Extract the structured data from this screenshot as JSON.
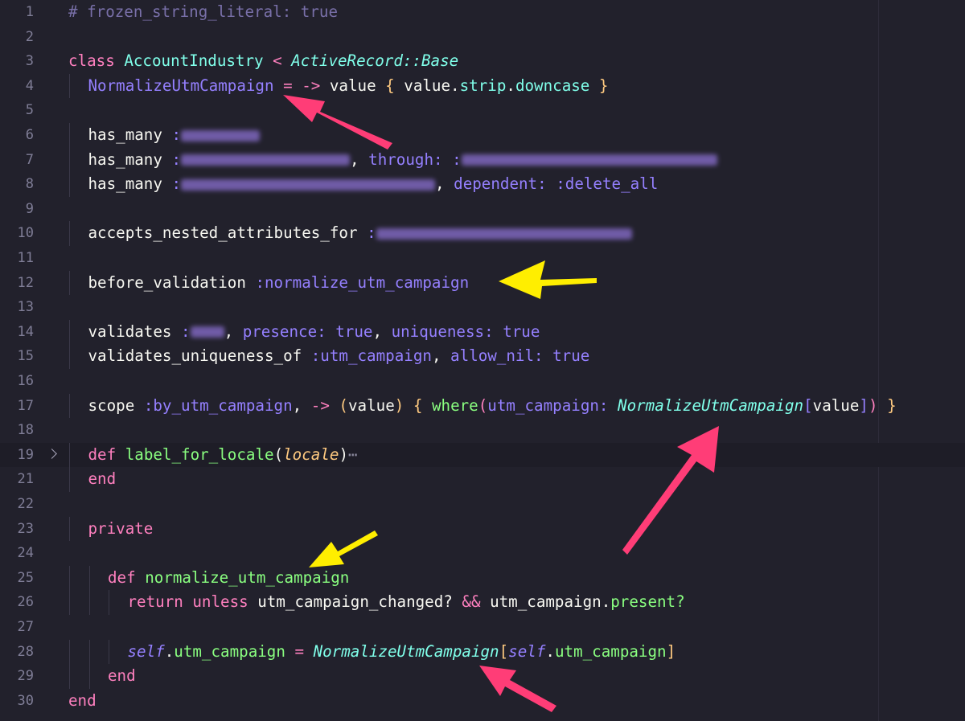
{
  "editor": {
    "lines": [
      {
        "n": "1",
        "segments": [
          {
            "t": "# frozen_string_literal: true",
            "c": "c-com"
          }
        ]
      },
      {
        "n": "2",
        "segments": []
      },
      {
        "n": "3",
        "segments": [
          {
            "t": "class ",
            "c": "c-kw"
          },
          {
            "t": "AccountIndustry",
            "c": "c-cls"
          },
          {
            "t": " < ",
            "c": "c-op"
          },
          {
            "t": "ActiveRecord::Base",
            "c": "c-anc"
          }
        ]
      },
      {
        "n": "4",
        "indent": 1,
        "segments": [
          {
            "t": "NormalizeUtmCampaign",
            "c": "c-const"
          },
          {
            "t": " = ",
            "c": "c-op"
          },
          {
            "t": "-> ",
            "c": "c-op"
          },
          {
            "t": "value ",
            "c": "c-plain"
          },
          {
            "t": "{ ",
            "c": "c-brk"
          },
          {
            "t": "value",
            "c": "c-plain"
          },
          {
            "t": ".",
            "c": "c-plain"
          },
          {
            "t": "strip",
            "c": "c-cyan"
          },
          {
            "t": ".",
            "c": "c-plain"
          },
          {
            "t": "downcase",
            "c": "c-cyan"
          },
          {
            "t": " }",
            "c": "c-brk"
          }
        ]
      },
      {
        "n": "5",
        "segments": []
      },
      {
        "n": "6",
        "indent": 1,
        "segments": [
          {
            "t": "has_many ",
            "c": "c-plain"
          },
          {
            "t": ":",
            "c": "c-sym"
          },
          {
            "blur": true,
            "w": 98
          }
        ]
      },
      {
        "n": "7",
        "indent": 1,
        "segments": [
          {
            "t": "has_many ",
            "c": "c-plain"
          },
          {
            "t": ":",
            "c": "c-sym"
          },
          {
            "blur": true,
            "w": 210
          },
          {
            "t": ", ",
            "c": "c-plain"
          },
          {
            "t": "through: ",
            "c": "c-sym"
          },
          {
            "t": ":",
            "c": "c-sym"
          },
          {
            "blur": true,
            "w": 318
          }
        ]
      },
      {
        "n": "8",
        "indent": 1,
        "segments": [
          {
            "t": "has_many ",
            "c": "c-plain"
          },
          {
            "t": ":",
            "c": "c-sym"
          },
          {
            "blur": true,
            "w": 316
          },
          {
            "t": ", ",
            "c": "c-plain"
          },
          {
            "t": "dependent: ",
            "c": "c-sym"
          },
          {
            "t": ":delete_all",
            "c": "c-sym"
          }
        ]
      },
      {
        "n": "9",
        "segments": []
      },
      {
        "n": "10",
        "indent": 1,
        "segments": [
          {
            "t": "accepts_nested_attributes_for ",
            "c": "c-plain"
          },
          {
            "t": ":",
            "c": "c-sym"
          },
          {
            "blur": true,
            "w": 318
          }
        ]
      },
      {
        "n": "11",
        "segments": []
      },
      {
        "n": "12",
        "indent": 1,
        "segments": [
          {
            "t": "before_validation ",
            "c": "c-plain"
          },
          {
            "t": ":normalize_utm_campaign",
            "c": "c-sym"
          }
        ]
      },
      {
        "n": "13",
        "segments": []
      },
      {
        "n": "14",
        "indent": 1,
        "segments": [
          {
            "t": "validates ",
            "c": "c-plain"
          },
          {
            "t": ":",
            "c": "c-sym"
          },
          {
            "blur": true,
            "w": 42
          },
          {
            "t": ", ",
            "c": "c-plain"
          },
          {
            "t": "presence: ",
            "c": "c-sym"
          },
          {
            "t": "true",
            "c": "c-bool"
          },
          {
            "t": ", ",
            "c": "c-plain"
          },
          {
            "t": "uniqueness: ",
            "c": "c-sym"
          },
          {
            "t": "true",
            "c": "c-bool"
          }
        ]
      },
      {
        "n": "15",
        "indent": 1,
        "segments": [
          {
            "t": "validates_uniqueness_of ",
            "c": "c-plain"
          },
          {
            "t": ":utm_campaign",
            "c": "c-sym"
          },
          {
            "t": ", ",
            "c": "c-plain"
          },
          {
            "t": "allow_nil: ",
            "c": "c-sym"
          },
          {
            "t": "true",
            "c": "c-bool"
          }
        ]
      },
      {
        "n": "16",
        "segments": []
      },
      {
        "n": "17",
        "indent": 1,
        "segments": [
          {
            "t": "scope ",
            "c": "c-plain"
          },
          {
            "t": ":by_utm_campaign",
            "c": "c-sym"
          },
          {
            "t": ", ",
            "c": "c-plain"
          },
          {
            "t": "-> ",
            "c": "c-op"
          },
          {
            "t": "(",
            "c": "c-brk"
          },
          {
            "t": "value",
            "c": "c-plain"
          },
          {
            "t": ")",
            "c": "c-brk"
          },
          {
            "t": " { ",
            "c": "c-brk"
          },
          {
            "t": "where",
            "c": "c-meth"
          },
          {
            "t": "(",
            "c": "c-pref"
          },
          {
            "t": "utm_campaign: ",
            "c": "c-sym"
          },
          {
            "t": "NormalizeUtmCampaign",
            "c": "c-anc"
          },
          {
            "t": "[",
            "c": "c-sym"
          },
          {
            "t": "value",
            "c": "c-plain"
          },
          {
            "t": "]",
            "c": "c-sym"
          },
          {
            "t": ")",
            "c": "c-pref"
          },
          {
            "t": " }",
            "c": "c-brk"
          }
        ]
      },
      {
        "n": "18",
        "segments": []
      },
      {
        "n": "19",
        "indent": 1,
        "fold": true,
        "current": true,
        "segments": [
          {
            "t": "def ",
            "c": "c-kw"
          },
          {
            "t": "label_for_locale",
            "c": "c-meth"
          },
          {
            "t": "(",
            "c": "c-plain"
          },
          {
            "t": "locale",
            "c": "c-par"
          },
          {
            "t": ")",
            "c": "c-plain"
          },
          {
            "t": "⋯",
            "c": "dots"
          }
        ]
      },
      {
        "n": "21",
        "indent": 1,
        "segments": [
          {
            "t": "end",
            "c": "c-kw"
          }
        ]
      },
      {
        "n": "22",
        "segments": []
      },
      {
        "n": "23",
        "indent": 1,
        "segments": [
          {
            "t": "private",
            "c": "c-kw"
          }
        ]
      },
      {
        "n": "24",
        "segments": []
      },
      {
        "n": "25",
        "indent": 2,
        "segments": [
          {
            "t": "def ",
            "c": "c-kw"
          },
          {
            "t": "normalize_utm_campaign",
            "c": "c-meth"
          }
        ]
      },
      {
        "n": "26",
        "indent": 3,
        "segments": [
          {
            "t": "return ",
            "c": "c-kw"
          },
          {
            "t": "unless ",
            "c": "c-kw"
          },
          {
            "t": "utm_campaign_changed? ",
            "c": "c-plain"
          },
          {
            "t": "&& ",
            "c": "c-op"
          },
          {
            "t": "utm_campaign",
            "c": "c-plain"
          },
          {
            "t": ".",
            "c": "c-plain"
          },
          {
            "t": "present?",
            "c": "c-meth"
          }
        ]
      },
      {
        "n": "27",
        "segments": []
      },
      {
        "n": "28",
        "indent": 3,
        "segments": [
          {
            "t": "self",
            "c": "c-self"
          },
          {
            "t": ".",
            "c": "c-plain"
          },
          {
            "t": "utm_campaign",
            "c": "c-meth"
          },
          {
            "t": " = ",
            "c": "c-op"
          },
          {
            "t": "NormalizeUtmCampaign",
            "c": "c-anc"
          },
          {
            "t": "[",
            "c": "c-brk"
          },
          {
            "t": "self",
            "c": "c-self"
          },
          {
            "t": ".",
            "c": "c-plain"
          },
          {
            "t": "utm_campaign",
            "c": "c-meth"
          },
          {
            "t": "]",
            "c": "c-brk"
          }
        ]
      },
      {
        "n": "29",
        "indent": 2,
        "segments": [
          {
            "t": "end",
            "c": "c-kw"
          }
        ]
      },
      {
        "n": "30",
        "segments": [
          {
            "t": "end",
            "c": "c-kw"
          }
        ]
      }
    ]
  },
  "annotations": {
    "arrow_colors": {
      "pink": "#ff3d77",
      "yellow": "#ffee00"
    }
  }
}
